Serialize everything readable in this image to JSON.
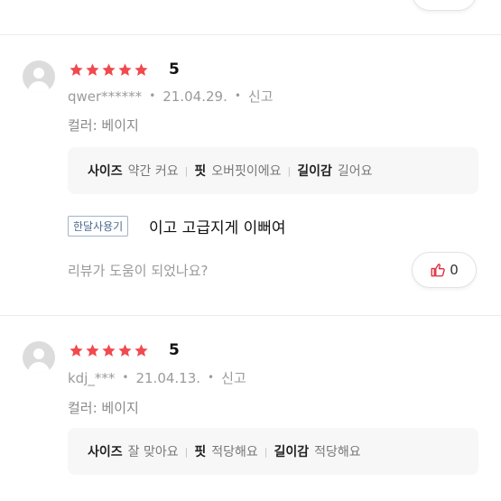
{
  "reviews": [
    {
      "rating": "5",
      "user": "qwer******",
      "date": "21.04.29.",
      "report": "신고",
      "color_option": "컬러: 베이지",
      "fit": {
        "size_label": "사이즈",
        "size_value": "약간 커요",
        "fit_label": "핏",
        "fit_value": "오버핏이에요",
        "length_label": "길이감",
        "length_value": "길어요"
      },
      "tag": "한달사용기",
      "content": "이고 고급지게 이뻐여",
      "helpful_question": "리뷰가 도움이 되었나요?",
      "like_count": "0"
    },
    {
      "rating": "5",
      "user": "kdj_***",
      "date": "21.04.13.",
      "report": "신고",
      "color_option": "컬러: 베이지",
      "fit": {
        "size_label": "사이즈",
        "size_value": "잘 맞아요",
        "fit_label": "핏",
        "fit_value": "적당해요",
        "length_label": "길이감",
        "length_value": "적당해요"
      }
    }
  ],
  "colors": {
    "star": "#f04a4f",
    "tag_border": "#9fb3cc",
    "thumb": "#e0283a"
  },
  "icons": {
    "avatar": "default-user-icon",
    "star": "star-icon",
    "like": "thumbs-up-icon"
  }
}
